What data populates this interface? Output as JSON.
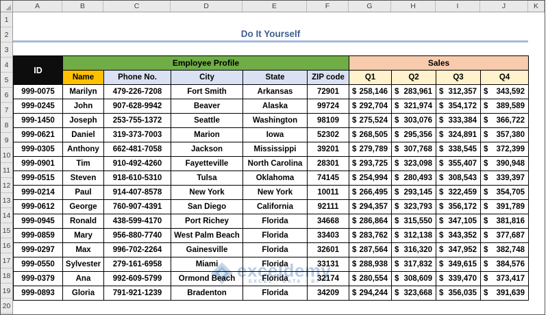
{
  "sheet_title": "Do It Yourself",
  "spreadsheet": {
    "column_letters": [
      "A",
      "B",
      "C",
      "D",
      "E",
      "F",
      "G",
      "H",
      "I",
      "J",
      "K"
    ],
    "row_numbers": [
      "1",
      "2",
      "3",
      "4",
      "5",
      "6",
      "7",
      "8",
      "9",
      "10",
      "11",
      "12",
      "13",
      "14",
      "15",
      "16",
      "17",
      "18",
      "19",
      "20"
    ]
  },
  "table": {
    "id_header": "ID",
    "employee_group_header": "Employee Profile",
    "sales_group_header": "Sales",
    "column_headers": {
      "name": "Name",
      "phone": "Phone No.",
      "city": "City",
      "state": "State",
      "zip": "ZIP code",
      "q1": "Q1",
      "q2": "Q2",
      "q3": "Q3",
      "q4": "Q4"
    },
    "currency_symbol": "$",
    "rows": [
      {
        "id": "999-0075",
        "name": "Marilyn",
        "phone": "479-226-7208",
        "city": "Fort Smith",
        "state": "Arkansas",
        "zip": "72901",
        "q1": "258,146",
        "q2": "283,961",
        "q3": "312,357",
        "q4": "343,592"
      },
      {
        "id": "999-0245",
        "name": "John",
        "phone": "907-628-9942",
        "city": "Beaver",
        "state": "Alaska",
        "zip": "99724",
        "q1": "292,704",
        "q2": "321,974",
        "q3": "354,172",
        "q4": "389,589"
      },
      {
        "id": "999-1450",
        "name": "Joseph",
        "phone": "253-755-1372",
        "city": "Seattle",
        "state": "Washington",
        "zip": "98109",
        "q1": "275,524",
        "q2": "303,076",
        "q3": "333,384",
        "q4": "366,722"
      },
      {
        "id": "999-0621",
        "name": "Daniel",
        "phone": "319-373-7003",
        "city": "Marion",
        "state": "Iowa",
        "zip": "52302",
        "q1": "268,505",
        "q2": "295,356",
        "q3": "324,891",
        "q4": "357,380"
      },
      {
        "id": "999-0305",
        "name": "Anthony",
        "phone": "662-481-7058",
        "city": "Jackson",
        "state": "Mississippi",
        "zip": "39201",
        "q1": "279,789",
        "q2": "307,768",
        "q3": "338,545",
        "q4": "372,399"
      },
      {
        "id": "999-0901",
        "name": "Tim",
        "phone": "910-492-4260",
        "city": "Fayetteville",
        "state": "North Carolina",
        "zip": "28301",
        "q1": "293,725",
        "q2": "323,098",
        "q3": "355,407",
        "q4": "390,948"
      },
      {
        "id": "999-0515",
        "name": "Steven",
        "phone": "918-610-5310",
        "city": "Tulsa",
        "state": "Oklahoma",
        "zip": "74145",
        "q1": "254,994",
        "q2": "280,493",
        "q3": "308,543",
        "q4": "339,397"
      },
      {
        "id": "999-0214",
        "name": "Paul",
        "phone": "914-407-8578",
        "city": "New York",
        "state": "New York",
        "zip": "10011",
        "q1": "266,495",
        "q2": "293,145",
        "q3": "322,459",
        "q4": "354,705"
      },
      {
        "id": "999-0612",
        "name": "George",
        "phone": "760-907-4391",
        "city": "San Diego",
        "state": "California",
        "zip": "92111",
        "q1": "294,357",
        "q2": "323,793",
        "q3": "356,172",
        "q4": "391,789"
      },
      {
        "id": "999-0945",
        "name": "Ronald",
        "phone": "438-599-4170",
        "city": "Port Richey",
        "state": "Florida",
        "zip": "34668",
        "q1": "286,864",
        "q2": "315,550",
        "q3": "347,105",
        "q4": "381,816"
      },
      {
        "id": "999-0859",
        "name": "Mary",
        "phone": "956-880-7740",
        "city": "West Palm Beach",
        "state": "Florida",
        "zip": "33403",
        "q1": "283,762",
        "q2": "312,138",
        "q3": "343,352",
        "q4": "377,687"
      },
      {
        "id": "999-0297",
        "name": "Max",
        "phone": "996-702-2264",
        "city": "Gainesville",
        "state": "Florida",
        "zip": "32601",
        "q1": "287,564",
        "q2": "316,320",
        "q3": "347,952",
        "q4": "382,748"
      },
      {
        "id": "999-0550",
        "name": "Sylvester",
        "phone": "279-161-6958",
        "city": "Miami",
        "state": "Florida",
        "zip": "33131",
        "q1": "288,938",
        "q2": "317,832",
        "q3": "349,615",
        "q4": "384,576"
      },
      {
        "id": "999-0379",
        "name": "Ana",
        "phone": "992-609-5799",
        "city": "Ormond Beach",
        "state": "Florida",
        "zip": "32174",
        "q1": "280,554",
        "q2": "308,609",
        "q3": "339,470",
        "q4": "373,417"
      },
      {
        "id": "999-0893",
        "name": "Gloria",
        "phone": "791-921-1239",
        "city": "Bradenton",
        "state": "Florida",
        "zip": "34209",
        "q1": "294,244",
        "q2": "323,668",
        "q3": "356,035",
        "q4": "391,639"
      }
    ]
  },
  "watermark": {
    "brand": "exceldemy",
    "tagline": "EXCEL · DATA · BI"
  },
  "colors": {
    "title-text": "#3F5E91",
    "title-underline": "#A3B8DE",
    "id-header-bg": "#0D0D0D",
    "employee-header-bg": "#70AD47",
    "sales-header-bg": "#F8CBAD",
    "name-header-bg": "#FFC000",
    "profile-subheader-bg": "#D9E1F2",
    "quarter-subheader-bg": "#FFF2CC"
  }
}
